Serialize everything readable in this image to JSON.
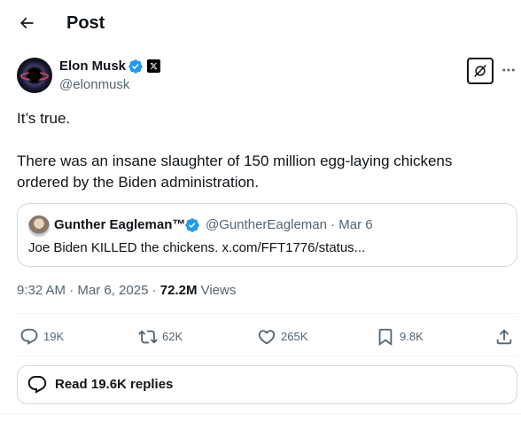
{
  "header": {
    "title": "Post",
    "back_icon": "arrow-left-icon"
  },
  "post": {
    "author": {
      "name": "Elon Musk",
      "handle": "@elonmusk",
      "verified_color": "#1d9bf0",
      "affiliate_icon": "x-logo-icon"
    },
    "text": [
      "It’s true.",
      "There was an insane slaughter of 150 million egg-laying chickens ordered by the Biden administration."
    ],
    "quote": {
      "name": "Gunther Eagleman™",
      "handle": "@GuntherEagleman · Mar 6",
      "text": "Joe Biden KILLED the chickens. x.com/FFT1776/status..."
    },
    "time": "9:32 AM · Mar 6, 2025 · ",
    "views_count": "72.2M",
    "views_label": " Views"
  },
  "actions": {
    "replies": "19K",
    "reposts": "62K",
    "likes": "265K",
    "bookmarks": "9.8K"
  },
  "read_replies": {
    "label": "Read 19.6K replies"
  },
  "colors": {
    "text": "#0f1419",
    "secondary": "#536471",
    "border": "#cfd9de",
    "accent": "#1d9bf0"
  }
}
